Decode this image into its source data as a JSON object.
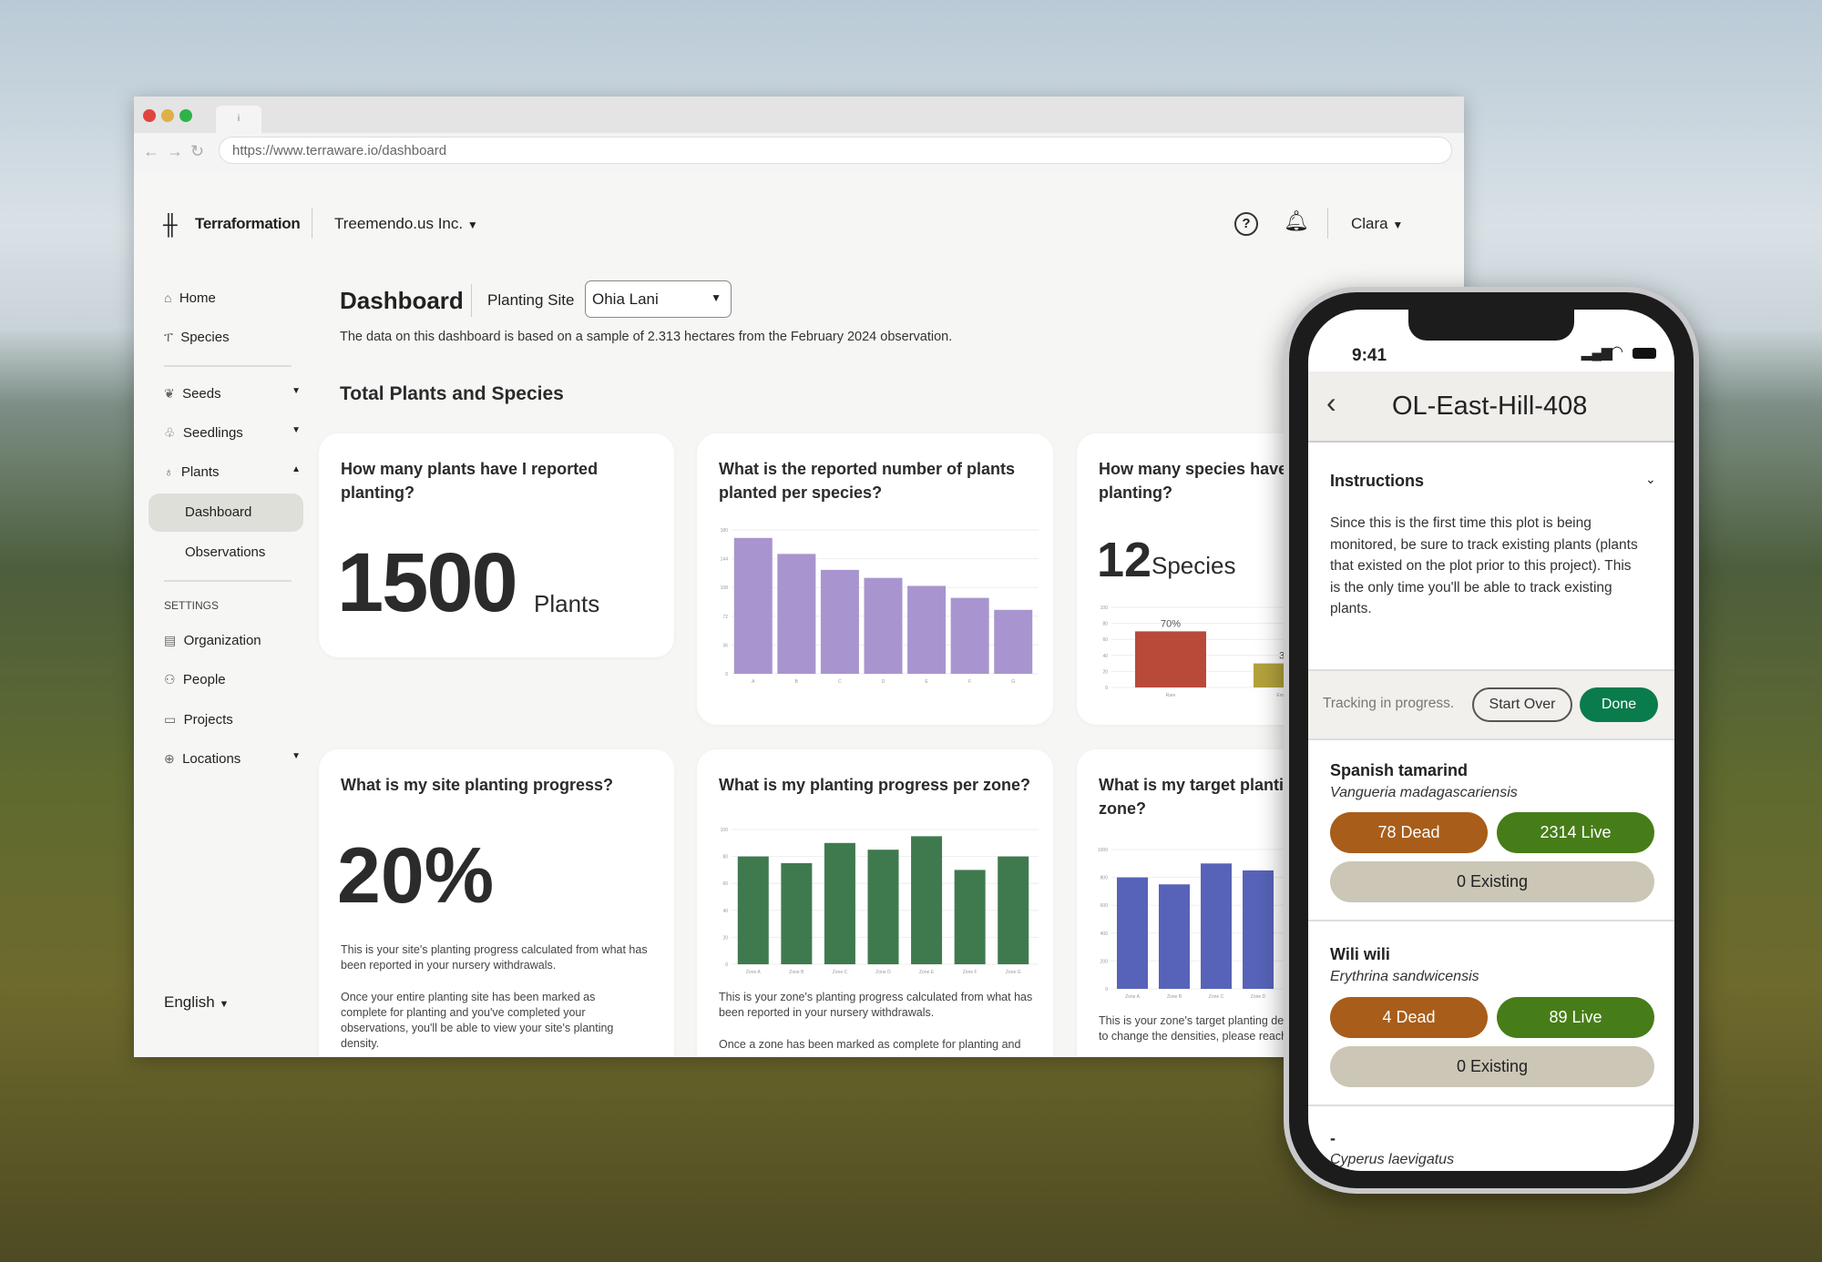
{
  "browser": {
    "url": "https://www.terraware.io/dashboard",
    "tab_icon": "i"
  },
  "header": {
    "logo": "Terraformation",
    "org": "Treemendo.us Inc.",
    "user": "Clara"
  },
  "sidebar": {
    "items": [
      {
        "label": "Home",
        "icon": "home-icon"
      },
      {
        "label": "Species",
        "icon": "species-icon"
      },
      {
        "label": "Seeds",
        "icon": "seeds-icon"
      },
      {
        "label": "Seedlings",
        "icon": "seedlings-icon"
      },
      {
        "label": "Plants",
        "icon": "plants-icon"
      },
      {
        "label": "Dashboard"
      },
      {
        "label": "Observations"
      }
    ],
    "settings_heading": "SETTINGS",
    "settings": [
      {
        "label": "Organization"
      },
      {
        "label": "People"
      },
      {
        "label": "Projects"
      },
      {
        "label": "Locations"
      }
    ],
    "language": "English"
  },
  "page": {
    "title": "Dashboard",
    "site_label": "Planting Site",
    "site_value": "Ohia Lani",
    "description": "The data on this dashboard is based on a sample of 2.313 hectares from the February 2024 observation.",
    "section": "Total Plants and Species"
  },
  "cards": {
    "plants": {
      "q": "How many plants have I reported planting?",
      "value": "1500",
      "unit": "Plants"
    },
    "per_species": {
      "q": "What is the reported number of plants planted per species?"
    },
    "species": {
      "q": "How many species have I reported planting?",
      "value": "12",
      "unit": "Species"
    },
    "progress": {
      "q": "What is my site planting progress?",
      "value": "20%",
      "p1": "This is your site's planting progress calculated from what has been reported in your nursery withdrawals.",
      "p2": "Once your entire planting site has been marked as complete for planting and you've completed your observations, you'll be able to view your site's planting density."
    },
    "zone": {
      "q": "What is my planting progress per zone?",
      "p1": "This is your zone's planting progress calculated from what has been reported in your nursery withdrawals.",
      "p2": "Once a zone has been marked as complete for planting and"
    },
    "target": {
      "q": "What is my target planting density per zone?",
      "p1": "This is your zone's target planting density provided. If you'd like to change the densities, please reach out to Terraformation."
    }
  },
  "chart_data": [
    {
      "type": "bar",
      "categories": [
        "A",
        "B",
        "C",
        "D",
        "E",
        "F",
        "G"
      ],
      "values": [
        170,
        150,
        130,
        120,
        110,
        95,
        80
      ],
      "ylim": [
        0,
        180
      ],
      "color": "#a895cf",
      "grid": true
    },
    {
      "type": "bar",
      "categories": [
        "Zone A",
        "Zone B",
        "Zone C",
        "Zone D",
        "Zone E",
        "Zone F",
        "Zone G"
      ],
      "values": [
        80,
        75,
        90,
        85,
        95,
        70,
        80
      ],
      "ylim": [
        0,
        100
      ],
      "color": "#3f7a4f",
      "grid": true
    },
    {
      "type": "bar",
      "categories": [
        "Rare",
        "Endangered"
      ],
      "values": [
        70,
        30
      ],
      "labels": [
        "70%",
        "30%"
      ],
      "ylim": [
        0,
        100
      ],
      "colors": [
        "#b94a3a",
        "#b3a23c"
      ],
      "grid": true
    },
    {
      "type": "bar",
      "categories": [
        "Zone A",
        "Zone B",
        "Zone C",
        "Zone D"
      ],
      "values": [
        800,
        750,
        900,
        850
      ],
      "ylim": [
        0,
        1000
      ],
      "color": "#5763b8",
      "grid": true
    }
  ],
  "phone": {
    "time": "9:41",
    "title": "OL-East-Hill-408",
    "instructions_title": "Instructions",
    "instructions": "Since this is the first time this plot is being monitored, be sure to track existing plants (plants that existed on the plot prior to this project). This is the only time you'll be able to track existing plants.",
    "tracking": "Tracking in progress.",
    "start_over": "Start Over",
    "done": "Done",
    "species": [
      {
        "common": "Spanish tamarind",
        "scientific": "Vangueria madagascariensis",
        "dead": "78 Dead",
        "live": "2314 Live",
        "existing": "0 Existing"
      },
      {
        "common": "Wili wili",
        "scientific": "Erythrina sandwicensis",
        "dead": "4 Dead",
        "live": "89 Live",
        "existing": "0 Existing"
      },
      {
        "common": "-",
        "scientific": "Cyperus laevigatus"
      }
    ]
  },
  "colors": {
    "accent": "#0a7b4b",
    "dead": "#a85d1a",
    "live": "#477d18",
    "existing": "#cbc6b6"
  }
}
